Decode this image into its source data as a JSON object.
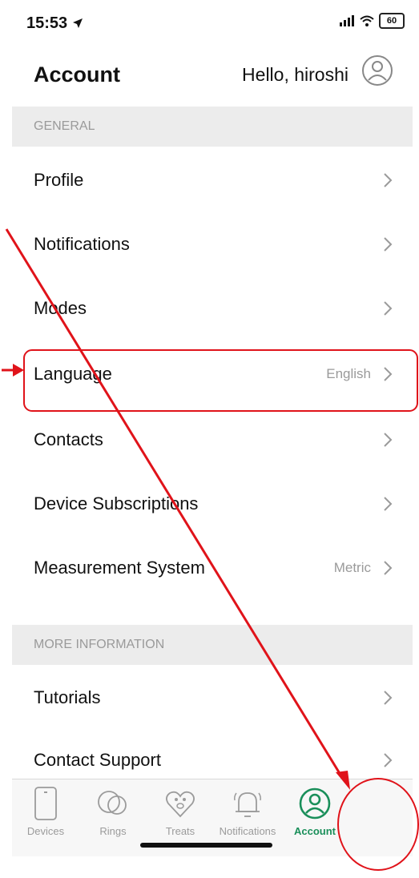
{
  "status_bar": {
    "time": "15:53",
    "battery": "60"
  },
  "header": {
    "title": "Account",
    "greeting": "Hello, hiroshi"
  },
  "sections": {
    "general": "GENERAL",
    "more_information": "MORE INFORMATION"
  },
  "rows": {
    "profile": {
      "label": "Profile"
    },
    "notifications": {
      "label": "Notifications"
    },
    "modes": {
      "label": "Modes"
    },
    "language": {
      "label": "Language",
      "value": "English"
    },
    "contacts": {
      "label": "Contacts"
    },
    "device_subscriptions": {
      "label": "Device Subscriptions"
    },
    "measurement_system": {
      "label": "Measurement System",
      "value": "Metric"
    },
    "tutorials": {
      "label": "Tutorials"
    },
    "contact_support": {
      "label": "Contact Support"
    }
  },
  "tabbar": {
    "devices": "Devices",
    "rings": "Rings",
    "treats": "Treats",
    "notifications": "Notifications",
    "account": "Account"
  },
  "colors": {
    "accent": "#1a8f5a",
    "annotation": "#e0131a",
    "section_bg": "#ececec",
    "muted_text": "#9a9a9a"
  }
}
